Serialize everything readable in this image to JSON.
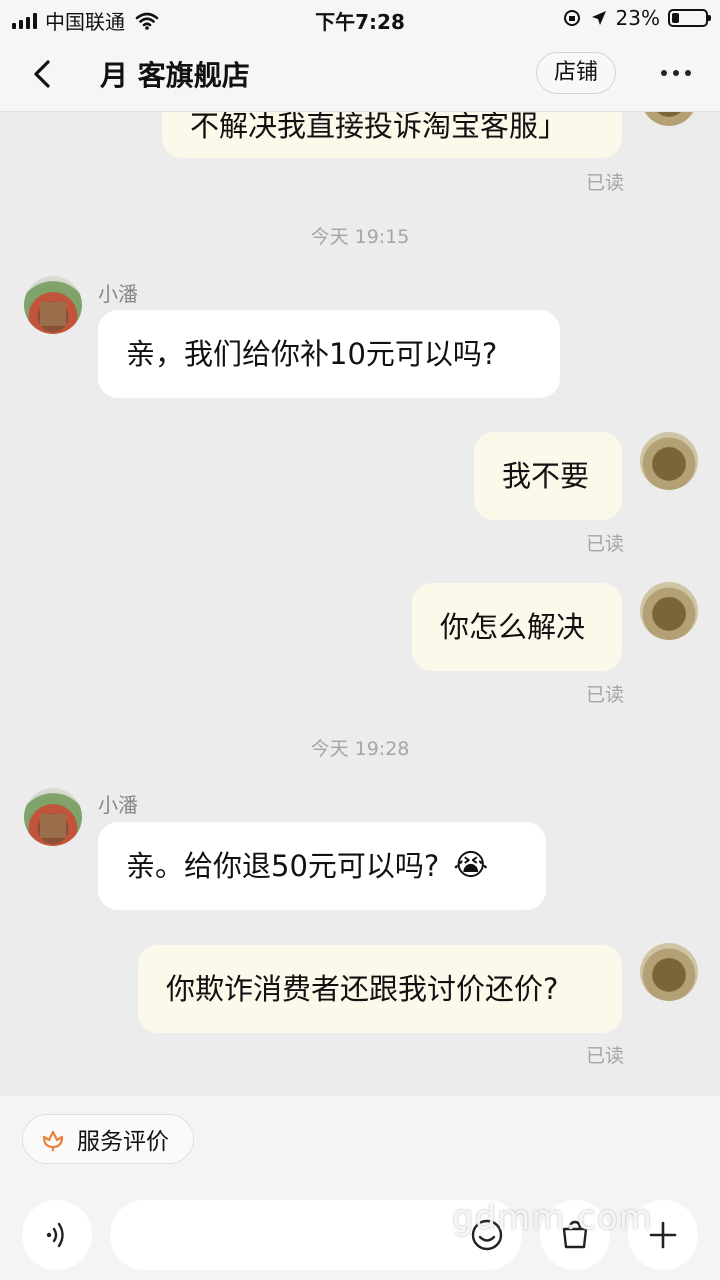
{
  "status_bar": {
    "carrier": "中国联通",
    "time": "下午7:28",
    "battery_text": "23%",
    "battery_level": 0.23
  },
  "header": {
    "title": "月  客旗舰店",
    "store_button": "店铺",
    "more_icon": "more-dots-icon",
    "back_icon": "chevron-left-icon"
  },
  "messages": {
    "m0": {
      "text": "不解决我直接投诉淘宝客服」",
      "status": "已读"
    },
    "t1": "今天 19:15",
    "m1": {
      "sender": "小潘",
      "text": "亲，我们给你补10元可以吗?"
    },
    "m2": {
      "text": "我不要",
      "status": "已读"
    },
    "m3": {
      "text": "你怎么解决",
      "status": "已读"
    },
    "t2": "今天 19:28",
    "m4": {
      "sender": "小潘",
      "text": "亲。给你退50元可以吗?",
      "emoji": "😭"
    },
    "m5": {
      "text": "你欺诈消费者还跟我讨价还价?",
      "status": "已读"
    }
  },
  "bottom_bar": {
    "rate_button": "服务评价",
    "rate_icon": "flower-icon",
    "input_placeholder": "",
    "voice_icon": "voice-icon",
    "emoji_icon": "smile-icon",
    "product_icon": "bag-icon",
    "plus_icon": "plus-icon"
  },
  "watermark": "gdmm.com",
  "colors": {
    "accent_orange": "#e8823a",
    "my_bubble": "#fcf8ea",
    "their_bubble": "#ffffff",
    "background": "#ececec"
  }
}
